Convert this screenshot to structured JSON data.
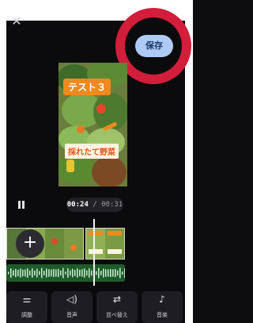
{
  "header": {
    "close_icon": "close-icon",
    "save_label": "保存",
    "highlight_color": "#d21e3a"
  },
  "preview": {
    "title_text": "テスト３",
    "subtitle_text": "採れたて野菜"
  },
  "playback": {
    "state_icon": "pause-icon",
    "current_time": "00:24",
    "separator": " / ",
    "total_time": "00:31"
  },
  "timeline": {
    "add_icon": "plus-icon"
  },
  "toolbar": {
    "items": [
      {
        "label": "調整",
        "icon": "adjust-icon"
      },
      {
        "label": "音声",
        "icon": "speaker-icon"
      },
      {
        "label": "並べ替え",
        "icon": "reorder-icon"
      },
      {
        "label": "音楽",
        "icon": "music-note-icon"
      }
    ]
  }
}
